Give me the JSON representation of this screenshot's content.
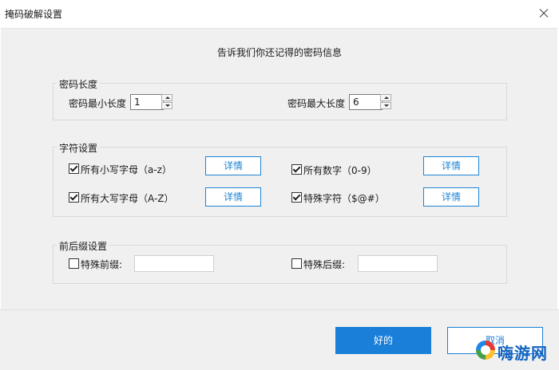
{
  "window": {
    "title": "掩码破解设置"
  },
  "info_title": "告诉我们你还记得的密码信息",
  "length_group": {
    "legend": "密码长度",
    "min_label": "密码最小长度",
    "min_value": "1",
    "max_label": "密码最大长度",
    "max_value": "6"
  },
  "charset_group": {
    "legend": "字符设置",
    "lowercase_label": "所有小写字母（a-z）",
    "uppercase_label": "所有大写字母（A-Z）",
    "digits_label": "所有数字（0-9）",
    "special_label": "特殊字符（$@#）",
    "detail_label": "详情",
    "lowercase_checked": true,
    "uppercase_checked": true,
    "digits_checked": true,
    "special_checked": true
  },
  "affix_group": {
    "legend": "前后缀设置",
    "prefix_label": "特殊前缀:",
    "prefix_value": "",
    "suffix_label": "特殊后缀:",
    "suffix_value": "",
    "prefix_checked": false,
    "suffix_checked": false
  },
  "footer": {
    "ok_label": "好的",
    "cancel_label": "取消"
  },
  "watermark": {
    "text": "嗨游网"
  },
  "colors": {
    "accent": "#1a7fd8",
    "background": "#f0f0f0"
  }
}
